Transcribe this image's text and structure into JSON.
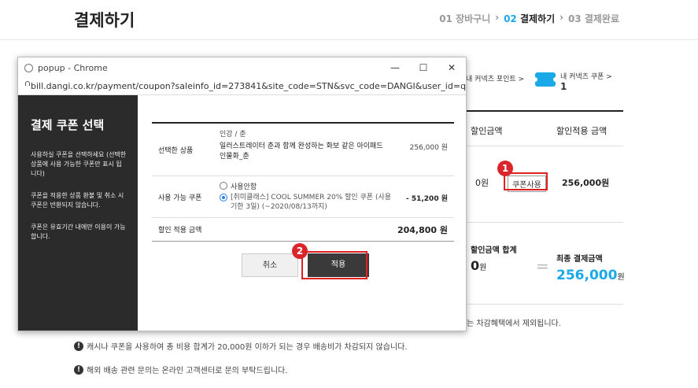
{
  "page": {
    "title": "결제하기",
    "steps": [
      {
        "num": "01",
        "label": "장바구니"
      },
      {
        "num": "02",
        "label": "결제하기"
      },
      {
        "num": "03",
        "label": "결제완료"
      }
    ]
  },
  "background": {
    "point_link": "내 커넥츠 포인트 >",
    "coupon_link": "내 커넥츠 쿠폰 >",
    "coupon_count": "1",
    "th_discount": "할인금액",
    "th_applied": "할인적용 금액",
    "row_discount": "0원",
    "coupon_button": "쿠폰사용",
    "row_price": "256,000원",
    "sum_label": "할인금액 합계",
    "sum_value": "0",
    "sum_unit": "원",
    "equal": "=",
    "final_label": "최종 결제금액",
    "final_value": "256,000",
    "final_unit": "원",
    "note_tail": "는 차감혜택에서 제외됩니다.",
    "notes": [
      "캐시나 쿠폰을 사용하여 총 비용 합계가 20,000원 이하가 되는 경우 배송비가 차감되지 않습니다.",
      "해외 배송 관련 문의는 온라인 고객센터로 문의 부탁드립니다."
    ]
  },
  "popup": {
    "window_title": "popup - Chrome",
    "url": "bill.dangi.co.kr/payment/coupon?saleinfo_id=273841&site_code=STN&svc_code=DANGI&user_id=qa...",
    "sidebar_title": "결제 쿠폰 선택",
    "sidebar_texts": [
      "사용하실 쿠폰을 선택하세요 (선택한 상품에 사용 가능한 쿠폰만 표시 됩니다)",
      "쿠폰을 적용한 상품 환불 및 취소 시 쿠폰은 반환되지 않습니다.",
      "쿠폰은 유효기간 내에만 이용이 가능합니다."
    ],
    "product_label": "선택한 상품",
    "product_category": "인강 / 춘",
    "product_name": "일러스트레이터 춘과 함께 완성하는 화보 같은 아이패드 인물화_춘",
    "product_price": "256,000 원",
    "coupon_label": "사용 가능 쿠폰",
    "option_none": "사용안함",
    "option_coupon": "[취미클래스] COOL SUMMER 20% 할인 쿠폰 (사용기한 3일) (~2020/08/13까지)",
    "coupon_discount": "- 51,200 원",
    "total_label": "할인 적용 금액",
    "total_value": "204,800 원",
    "cancel_button": "취소",
    "apply_button": "적용"
  },
  "annotations": {
    "badge1": "1",
    "badge2": "2"
  },
  "colors": {
    "accent": "#1aa9e8",
    "highlight": "#e02020",
    "dark_button": "#3a3a3a"
  }
}
